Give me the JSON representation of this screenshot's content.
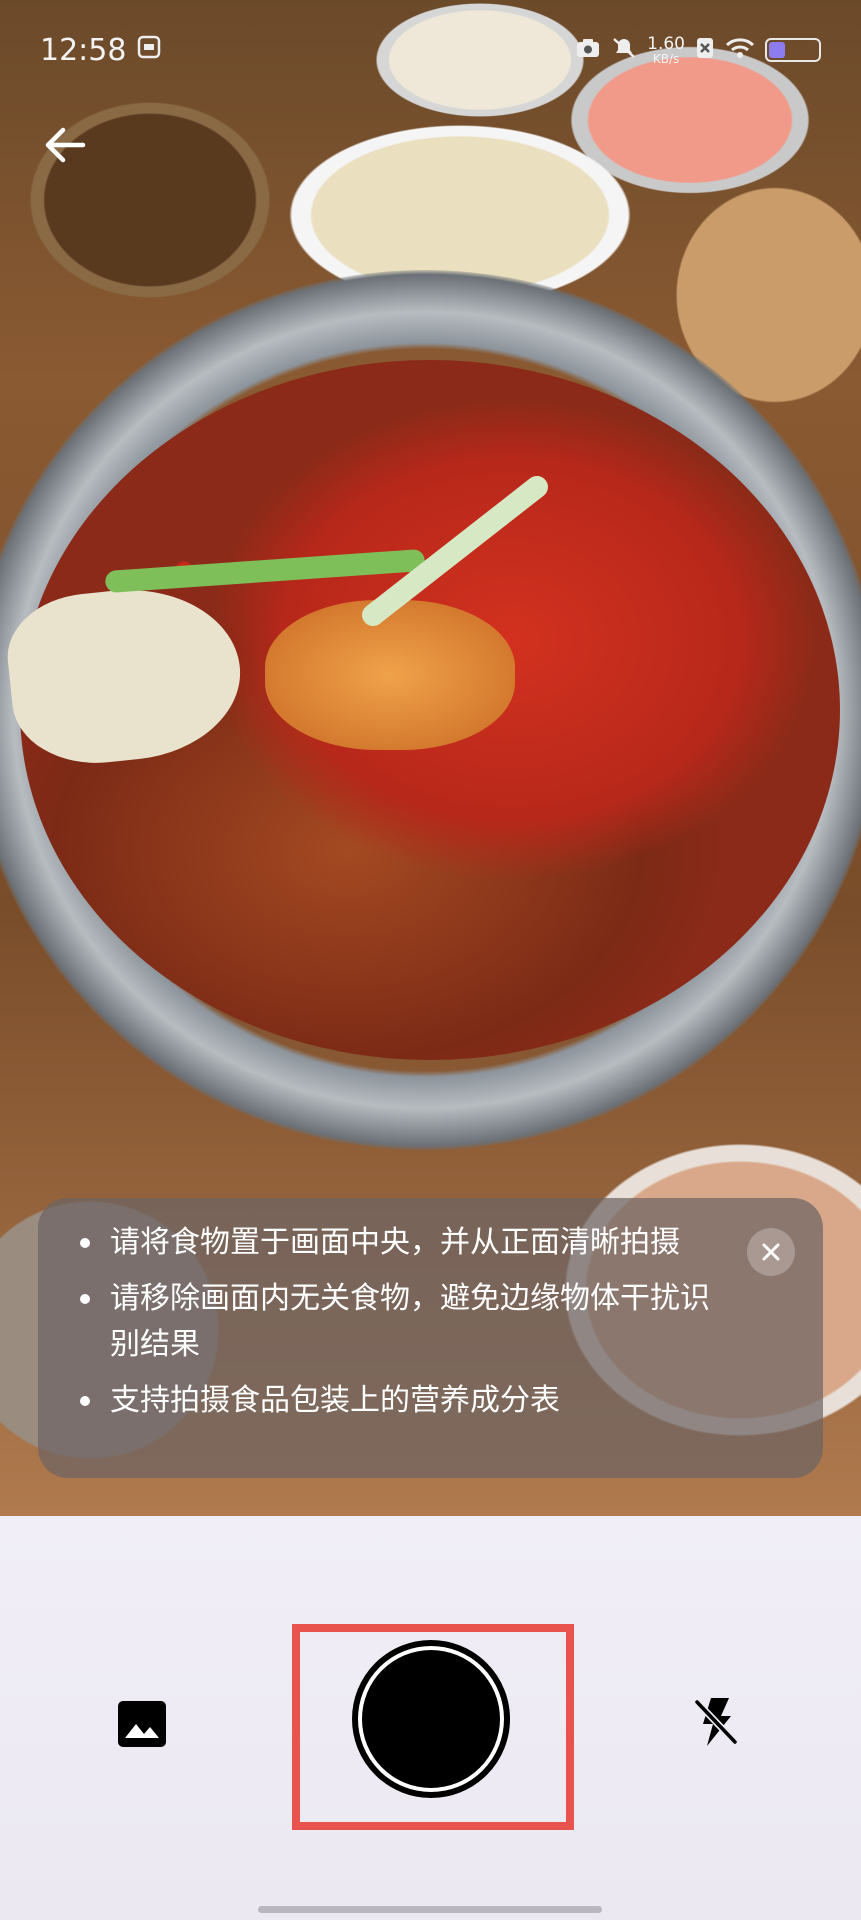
{
  "status_bar": {
    "time": "12:58",
    "net_speed_value": "1.60",
    "net_speed_unit": "KB/s",
    "battery_accent": "#8b7cf0"
  },
  "tips": {
    "items": [
      "请将食物置于画面中央，并从正面清晰拍摄",
      "请移除画面内无关食物，避免边缘物体干扰识别结果",
      "支持拍摄食品包装上的营养成分表"
    ],
    "close_icon": "close-icon"
  },
  "controls": {
    "gallery_icon": "image-icon",
    "shutter_icon": "shutter-button",
    "flash_icon": "flash-off-icon",
    "highlight_color": "#e8534d"
  },
  "icons": {
    "back": "arrow-left-icon"
  }
}
